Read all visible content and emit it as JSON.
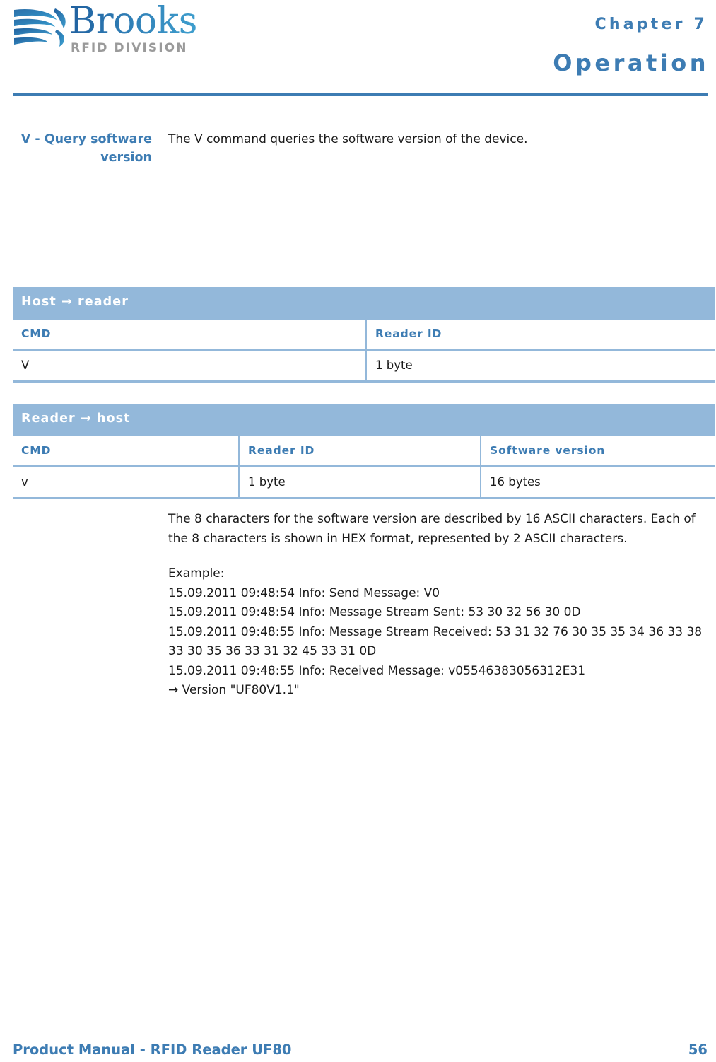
{
  "header": {
    "logo": {
      "wordmark": "Brooks",
      "tagline": "RFID DIVISION",
      "mark_icon": "brooks-swoosh-logo-icon"
    },
    "chapter": "Chapter 7",
    "title": "Operation"
  },
  "section": {
    "marginal_heading": "V - Query software version",
    "intro": "The V command queries the software version of the device."
  },
  "tables": [
    {
      "band": "Host → reader",
      "columns": [
        "CMD",
        "Reader ID"
      ],
      "rows": [
        [
          "V",
          "1 byte"
        ]
      ]
    },
    {
      "band": "Reader → host",
      "columns": [
        "CMD",
        "Reader ID",
        "Software version"
      ],
      "rows": [
        [
          "v",
          "1 byte",
          "16 bytes"
        ]
      ]
    }
  ],
  "body": {
    "paragraph": "The 8 characters for the software version are described by 16 ASCII characters. Each of the 8 characters is shown in HEX format, represented by 2 ASCII characters.",
    "example_label": "Example:",
    "log_lines": [
      "15.09.2011 09:48:54 Info: Send Message: V0",
      "15.09.2011 09:48:54 Info: Message Stream Sent: 53 30 32 56 30 0D",
      "15.09.2011 09:48:55 Info: Message Stream Received: 53 31 32 76 30 35 35 34 36 33 38 33 30 35 36 33 31 32 45 33 31 0D",
      "15.09.2011 09:48:55 Info: Received Message: v05546383056312E31",
      "→ Version \"UF80V1.1\""
    ]
  },
  "footer": {
    "title": "Product Manual - RFID Reader UF80",
    "page_number": "56"
  },
  "colors": {
    "accent_blue": "#3d7cb3",
    "band_blue": "#93b8da",
    "tagline_gray": "#9a9a9a"
  }
}
